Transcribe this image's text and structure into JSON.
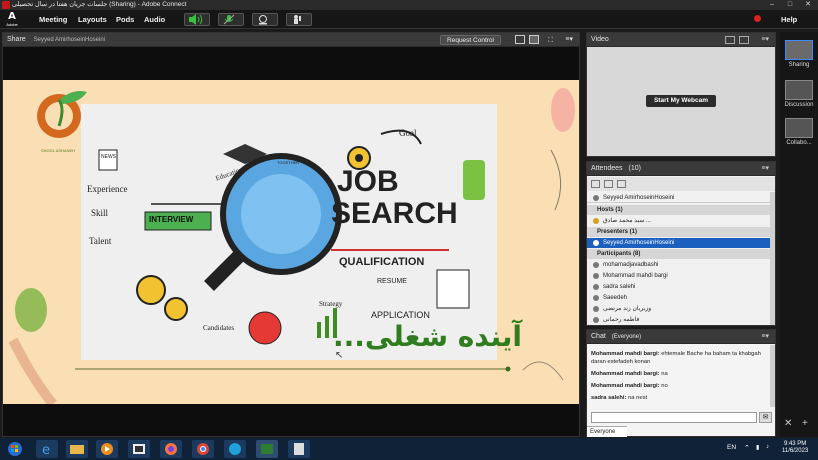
{
  "window": {
    "title": "جلسات جریان هفتا در سال تحصیلی (Sharing) - Adobe Connect"
  },
  "app": {
    "logo_letter": "A",
    "logo_text": "Adobe"
  },
  "menu": {
    "items": [
      "Meeting",
      "Layouts",
      "Pods",
      "Audio"
    ],
    "help": "Help"
  },
  "share": {
    "title": "Share",
    "presenter": "Seyyed AmirhoseinHoseini",
    "request_control": "Request Control"
  },
  "slide": {
    "logo_caption": "SHOGL ASHANEH",
    "headline_1": "JOB",
    "headline_2": "SEARCH",
    "words": [
      "Goal",
      "QUALIFICATION",
      "RESUME",
      "APPLICATION",
      "Strategy",
      "Candidates",
      "Experience",
      "Skill",
      "INTERVIEW",
      "Talent",
      "Education",
      "NEWS",
      "TOGETHER"
    ],
    "persian_title": "آینده شغلی..."
  },
  "video": {
    "title": "Video",
    "start_webcam": "Start My Webcam"
  },
  "attendees": {
    "title": "Attendees",
    "count": "(10)",
    "current_user": "Seyyed AmirhoseinHoseini",
    "hosts_label": "Hosts (1)",
    "host_name": "سید محمد صادق ...",
    "presenters_label": "Presenters (1)",
    "presenter_name": "Seyyed AmirhoseinHoseini",
    "participants_label": "Participants (8)",
    "participants": [
      "mohamadjavadbashi",
      "Mohammad mahdi bargi",
      "sadra salehi",
      "Saeedeh",
      "وزیریان زند مرتضی",
      "فاطمه رحمانی"
    ]
  },
  "chat": {
    "title": "Chat",
    "audience": "(Everyone)",
    "messages": [
      {
        "sender": "Mohammad mahdi bargi:",
        "text": "ehtemale Bache ha baham ta khabgah daran estefadeh konan"
      },
      {
        "sender": "Mohammad mahdi bargi:",
        "text": "na"
      },
      {
        "sender": "Mohammad mahdi bargi:",
        "text": "no"
      },
      {
        "sender": "sadra salehi:",
        "text": "na nest"
      }
    ],
    "tab": "Everyone"
  },
  "sidebar": {
    "items": [
      "Sharing",
      "Discussion",
      "Collabo..."
    ]
  },
  "taskbar": {
    "lang": "EN",
    "time": "9:43 PM",
    "date": "11/6/2023"
  }
}
